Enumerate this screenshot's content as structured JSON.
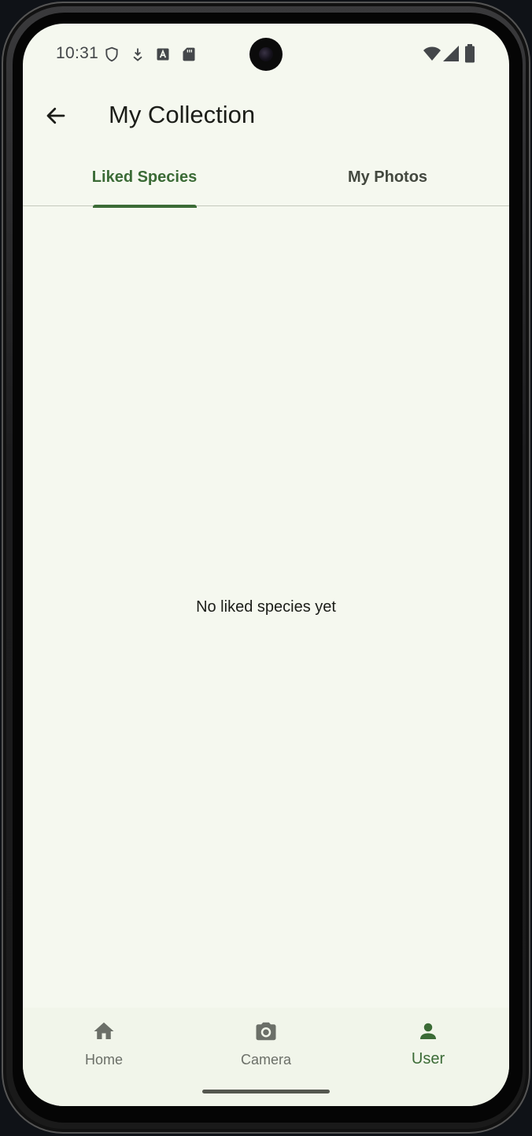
{
  "status_bar": {
    "time": "10:31",
    "left_icons": [
      "shield-icon",
      "download-icon",
      "font-icon",
      "sd-card-icon"
    ],
    "right_icons": [
      "wifi-icon",
      "signal-icon",
      "battery-icon"
    ]
  },
  "app_bar": {
    "back_icon": "arrow-back-icon",
    "title": "My Collection"
  },
  "tabs": [
    {
      "label": "Liked Species",
      "selected": true
    },
    {
      "label": "My Photos",
      "selected": false
    }
  ],
  "content": {
    "empty_message": "No liked species yet"
  },
  "bottom_nav": {
    "items": [
      {
        "label": "Home",
        "icon": "home-icon",
        "selected": false
      },
      {
        "label": "Camera",
        "icon": "camera-icon",
        "selected": false
      },
      {
        "label": "User",
        "icon": "user-icon",
        "selected": true
      }
    ]
  },
  "colors": {
    "background": "#f5f8ef",
    "accent": "#3b6b36",
    "text": "#1b1d18",
    "inactive": "#6b6f68"
  }
}
